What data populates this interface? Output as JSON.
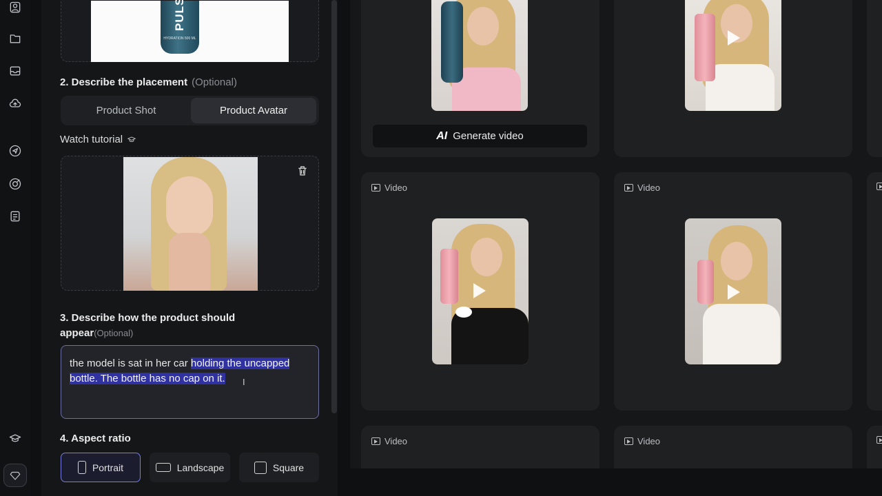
{
  "panel": {
    "product": {
      "brand": "PULSE",
      "sub": "HYDRATION\n500 ML"
    },
    "step2": {
      "title": "2. Describe the placement",
      "optional": "(Optional)"
    },
    "placement_options": [
      "Product Shot",
      "Product Avatar"
    ],
    "selected_placement": "Product Avatar",
    "watch_tutorial": "Watch tutorial",
    "step3": {
      "title_line1": "3. Describe how the product should",
      "title_line2": "appear",
      "optional": "(Optional)"
    },
    "prompt": {
      "plain": "the model is sat in her car ",
      "selected": "holding the uncapped bottle. The bottle has no cap on it. "
    },
    "step4": {
      "title": "4. Aspect ratio"
    },
    "ratios": [
      "Portrait",
      "Landscape",
      "Square"
    ],
    "selected_ratio": "Portrait"
  },
  "gallery": {
    "generate_label": "Generate video",
    "ai_badge": "AI",
    "card_label": "Video",
    "cards": [
      {
        "label": ""
      },
      {
        "label": ""
      },
      {
        "label": "Video"
      },
      {
        "label": "Video"
      },
      {
        "label": "Video"
      },
      {
        "label": "Video"
      }
    ]
  },
  "colors": {
    "accent": "#7a7de0",
    "selection": "#2f32a0",
    "product_pink": "#f0a7b1",
    "bottle_teal": "#2c5a6d"
  }
}
